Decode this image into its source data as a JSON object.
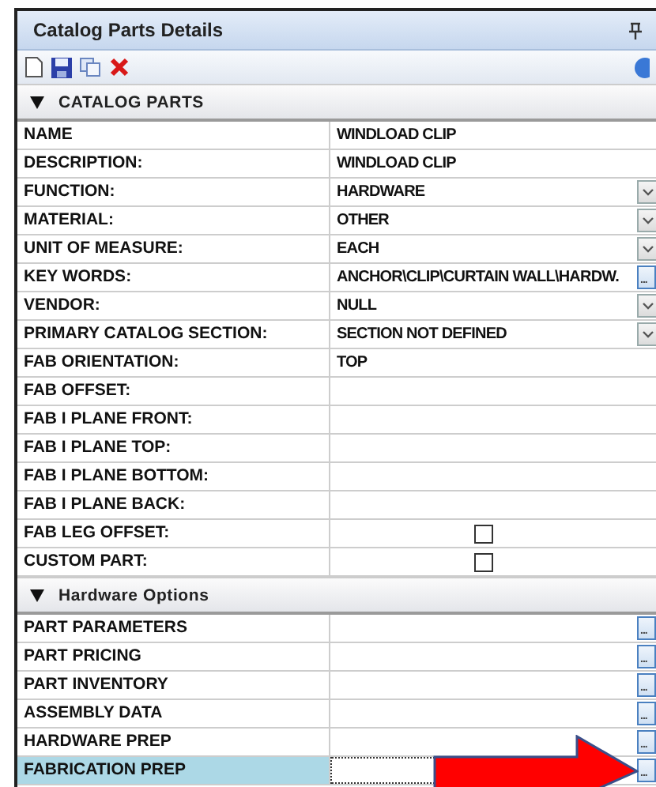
{
  "window": {
    "title": "Catalog Parts Details"
  },
  "ellipsis_label": "...",
  "sections": [
    {
      "title": "CATALOG PARTS",
      "expanded": true,
      "rows": [
        {
          "label": "NAME",
          "kind": "text",
          "value": "WINDLOAD CLIP"
        },
        {
          "label": "DESCRIPTION:",
          "kind": "text",
          "value": "WINDLOAD CLIP"
        },
        {
          "label": "FUNCTION:",
          "kind": "dropdown",
          "value": "HARDWARE"
        },
        {
          "label": "MATERIAL:",
          "kind": "dropdown",
          "value": "OTHER"
        },
        {
          "label": "UNIT OF MEASURE:",
          "kind": "dropdown",
          "value": "EACH"
        },
        {
          "label": "KEY WORDS:",
          "kind": "ellipsis",
          "value": "ANCHOR\\CLIP\\CURTAIN WALL\\HARDW."
        },
        {
          "label": "VENDOR:",
          "kind": "dropdown",
          "value": "NULL"
        },
        {
          "label": "PRIMARY CATALOG SECTION:",
          "kind": "dropdown",
          "value": "SECTION NOT DEFINED"
        },
        {
          "label": "FAB ORIENTATION:",
          "kind": "text",
          "value": "TOP"
        },
        {
          "label": "FAB OFFSET:",
          "kind": "text"
        },
        {
          "label": "FAB I PLANE FRONT:",
          "kind": "text"
        },
        {
          "label": "FAB I PLANE TOP:",
          "kind": "text"
        },
        {
          "label": "FAB I PLANE BOTTOM:",
          "kind": "text"
        },
        {
          "label": "FAB I PLANE BACK:",
          "kind": "text"
        },
        {
          "label": "FAB LEG OFFSET:",
          "kind": "checkbox",
          "checked": false
        },
        {
          "label": "CUSTOM PART:",
          "kind": "checkbox",
          "checked": false
        }
      ]
    },
    {
      "title": "Hardware Options",
      "expanded": true,
      "rows": [
        {
          "label": "PART PARAMETERS",
          "kind": "ellipsis",
          "selected": false
        },
        {
          "label": "PART PRICING",
          "kind": "ellipsis",
          "selected": false
        },
        {
          "label": "PART INVENTORY",
          "kind": "ellipsis",
          "selected": false
        },
        {
          "label": "ASSEMBLY DATA",
          "kind": "ellipsis",
          "selected": false
        },
        {
          "label": "HARDWARE PREP",
          "kind": "ellipsis",
          "selected": false
        },
        {
          "label": "FABRICATION PREP",
          "kind": "ellipsis",
          "selected": true
        }
      ]
    }
  ]
}
